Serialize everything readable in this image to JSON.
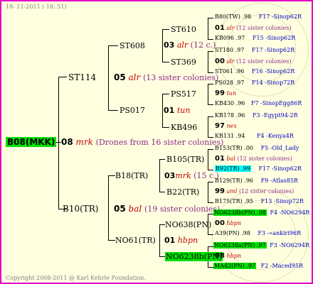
{
  "header": {
    "date": "18- 11-2011 ( 18: 51)"
  },
  "footer": {
    "copyright": "Copyright 2008-2011 @ Karl Kehrle Foundation."
  },
  "root": {
    "name": "B08(MKK)"
  },
  "gen1": {
    "num": "08",
    "race": "mrk",
    "note": "(Drones from 16 sister colonies)"
  },
  "left_sire": {
    "name": "ST114",
    "queen": {
      "num": "05",
      "race": "alr",
      "note": "(13 sister colonies)"
    },
    "left": {
      "name": "ST608",
      "queen": {
        "num": "03",
        "race": "alr",
        "note": "(12 c.)"
      },
      "a": {
        "name": "ST610",
        "r1": {
          "id": "B80(TW)",
          "year": ".98",
          "pedigree": "F17 -Sinop62R"
        },
        "r2": {
          "num": "01",
          "race": "alr",
          "note": "(12 sister colonies)"
        },
        "r3": {
          "id": "KB096",
          "year": ".97",
          "pedigree": "F15 -Sinop62R"
        }
      },
      "b": {
        "name": "ST369",
        "r1": {
          "id": "ST180",
          "year": ".97",
          "pedigree": "F17 -Sinop62R"
        },
        "r2": {
          "num": "00",
          "race": "alr",
          "note": "(12 sister colonies)"
        },
        "r3": {
          "id": "ST061",
          "year": ".96",
          "pedigree": "F16 -Sinop62R"
        }
      }
    },
    "right": {
      "name": "PS017",
      "queen": {
        "num": "01",
        "race": "tun"
      },
      "a": {
        "name": "PS517",
        "r1": {
          "id": "PS028",
          "year": ".97",
          "pedigree": "F14 -Sinop72R"
        },
        "r2": {
          "num": "99",
          "race": "tun"
        },
        "r3": {
          "id": "KB430",
          "year": ".96",
          "pedigree": "F7 -SinopEgg86R"
        }
      },
      "b": {
        "name": "KB496",
        "r1": {
          "id": "KB178",
          "year": ".96",
          "pedigree": "F3 -Egypt94-2R"
        },
        "r2": {
          "num": "97",
          "race": "nex"
        },
        "r3": {
          "id": "KB131",
          "year": ".94",
          "pedigree": "F4 -Kenya4R"
        }
      }
    }
  },
  "right_sire": {
    "name": "B10(TR)",
    "queen": {
      "num": "05",
      "race": "bal",
      "note": "(19 sister colonies)"
    },
    "left": {
      "name": "B18(TR)",
      "queen": {
        "num": "03",
        "race": "mrk",
        "note": "(15 c.)"
      },
      "a": {
        "name": "B105(TR)",
        "r1": {
          "id": "B153(TR)",
          "year": ".00",
          "pedigree": "F5 -Old_Lady"
        },
        "r2": {
          "num": "01",
          "race": "bal",
          "note": "(12 sister colonies)"
        },
        "r3": {
          "id": "B92(TR)",
          "year": ".99",
          "pedigree": "F17 -Sinop62R"
        }
      },
      "b": {
        "name": "B22(TR)",
        "r1": {
          "id": "B129(TR)",
          "year": ".96",
          "pedigree": "F9 -Atlas85R"
        },
        "r2": {
          "num": "99",
          "race": "aml",
          "note": "(12 sister colonies)"
        },
        "r3": {
          "id": "B175(TR)",
          "year": ".95",
          "pedigree": "F13 -Sinop72R"
        }
      }
    },
    "right": {
      "name": "NO61(TR)",
      "queen": {
        "num": "01",
        "race": "hbpn"
      },
      "a": {
        "name": "NO638(PN)",
        "r1": {
          "id": "NO6238b(PN)",
          "year": ".98",
          "pedigree": "F4 -NO6294R"
        },
        "r2": {
          "num": "00",
          "race": "hbpn"
        },
        "r3": {
          "id": "A39(PN)",
          "year": ".98",
          "pedigree": "F3 -«ankiri96R"
        }
      },
      "b": {
        "name": "NO6238b(PN)",
        "r1": {
          "id": "NO6238a(PN)",
          "year": ".97",
          "pedigree": "F3 -NO6294R"
        },
        "r2": {
          "num": "98",
          "race": "hbpn"
        },
        "r3": {
          "id": "MA42(PN)",
          "year": ".97",
          "pedigree": "F2 -Maced95R"
        }
      }
    }
  }
}
